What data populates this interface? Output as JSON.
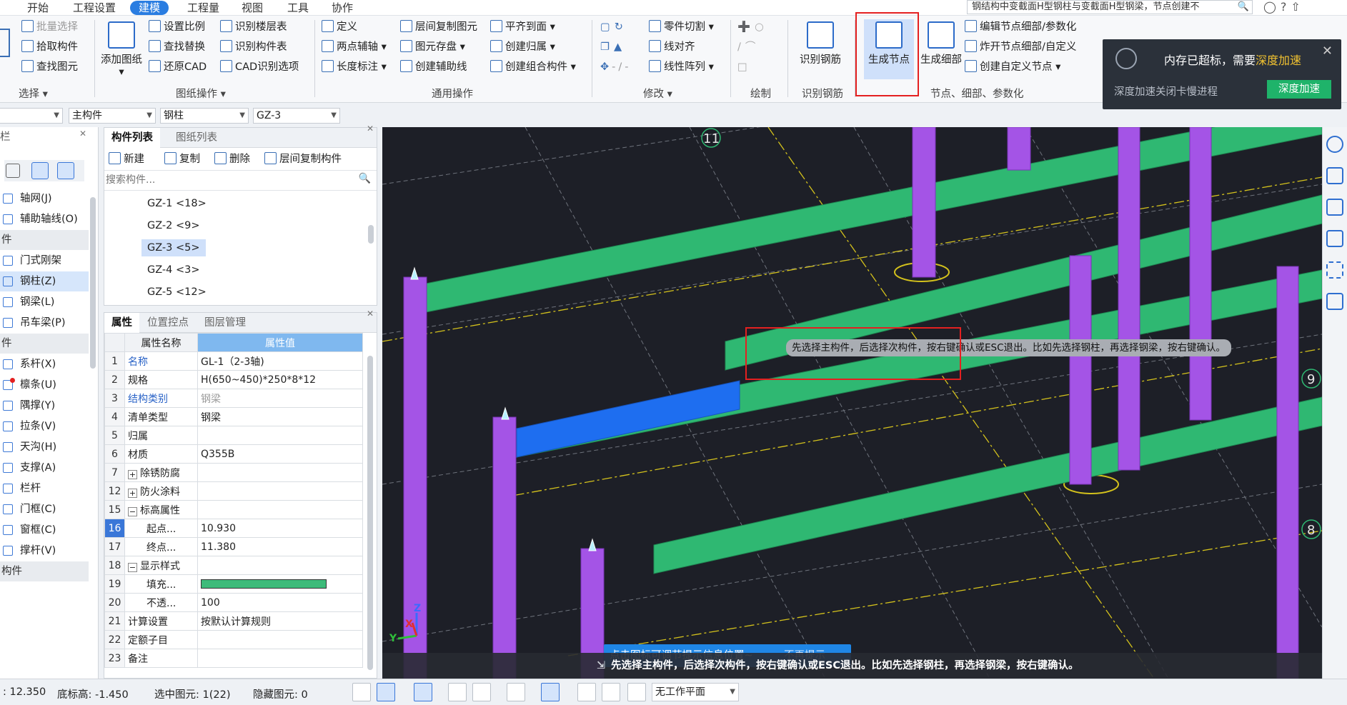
{
  "menu": {
    "items": [
      "开始",
      "工程设置",
      "建模",
      "工程量",
      "视图",
      "工具",
      "协作"
    ],
    "active_index": 2
  },
  "search": {
    "text": "钢结构中变截面H型钢柱与变截面H型钢梁，节点创建不"
  },
  "ribbon": {
    "select_group": {
      "rows": [
        "批量选择",
        "拾取构件",
        "查找图元"
      ],
      "label": "选择"
    },
    "drawing_ops": {
      "big": "添加图纸",
      "col1": [
        "设置比例",
        "查找替换",
        "还原CAD"
      ],
      "col2": [
        "识别楼层表",
        "识别构件表",
        "CAD识别选项"
      ],
      "label": "图纸操作"
    },
    "general_ops": {
      "col1": [
        "定义",
        "两点辅轴",
        "长度标注"
      ],
      "col2": [
        "层间复制图元",
        "图元存盘",
        "创建辅助线"
      ],
      "col3": [
        "平齐到面",
        "创建归属",
        "创建组合构件"
      ],
      "label": "通用操作"
    },
    "modify": {
      "col2": [
        "零件切割",
        "线对齐",
        "线性阵列"
      ],
      "label": "修改"
    },
    "draw": {
      "label": "绘制"
    },
    "identify": {
      "big": "识别钢筋",
      "label": "识别钢筋"
    },
    "node_group": {
      "big1": "生成节点",
      "big2": "生成细部",
      "col": [
        "编辑节点细部/参数化",
        "炸开节点细部/自定义",
        "创建自定义节点"
      ],
      "label": "节点、细部、参数化"
    }
  },
  "notification": {
    "title_prefix": "内存已超标，需要",
    "title_link": "深度加速",
    "subtitle": "深度加速关闭卡慢进程",
    "button": "深度加速"
  },
  "selectors": {
    "s1": "主构件",
    "s2": "钢柱",
    "s3": "GZ-3"
  },
  "left_sidebar": {
    "header": "栏",
    "items": [
      {
        "label": "轴网(J)"
      },
      {
        "label": "辅助轴线(O)"
      },
      {
        "label": "件",
        "section": true
      },
      {
        "label": "门式刚架"
      },
      {
        "label": "钢柱(Z)",
        "selected": true
      },
      {
        "label": "钢梁(L)"
      },
      {
        "label": "吊车梁(P)"
      },
      {
        "label": "件",
        "section": true
      },
      {
        "label": "系杆(X)"
      },
      {
        "label": "檩条(U)"
      },
      {
        "label": "隅撑(Y)"
      },
      {
        "label": "拉条(V)"
      },
      {
        "label": "天沟(H)"
      },
      {
        "label": "支撑(A)"
      },
      {
        "label": "栏杆"
      },
      {
        "label": "门框(C)"
      },
      {
        "label": "窗框(C)"
      },
      {
        "label": "撑杆(V)"
      },
      {
        "label": "构件",
        "section": true
      }
    ]
  },
  "component_panel": {
    "tabs": [
      "构件列表",
      "图纸列表"
    ],
    "toolbar": {
      "new": "新建",
      "copy": "复制",
      "delete": "删除",
      "floor_copy": "层间复制构件"
    },
    "search_placeholder": "搜索构件...",
    "items": [
      "GZ-1 <18>",
      "GZ-2 <9>",
      "GZ-3 <5>",
      "GZ-4 <3>",
      "GZ-5 <12>"
    ],
    "selected_index": 2
  },
  "property_panel": {
    "tabs": [
      "属性",
      "位置控点",
      "图层管理"
    ],
    "header": {
      "name": "属性名称",
      "value": "属性值"
    },
    "rows": [
      {
        "n": "1",
        "name": "名称",
        "value": "GL-1（2-3轴)",
        "link": true
      },
      {
        "n": "2",
        "name": "规格",
        "value": "H(650~450)*250*8*12"
      },
      {
        "n": "3",
        "name": "结构类别",
        "value": "钢梁",
        "link": true,
        "gray": true
      },
      {
        "n": "4",
        "name": "清单类型",
        "value": "钢梁"
      },
      {
        "n": "5",
        "name": "归属",
        "value": ""
      },
      {
        "n": "6",
        "name": "材质",
        "value": "Q355B"
      },
      {
        "n": "7",
        "name": "除锈防腐",
        "value": "",
        "expand": "+"
      },
      {
        "n": "12",
        "name": "防火涂料",
        "value": "",
        "expand": "+"
      },
      {
        "n": "15",
        "name": "标高属性",
        "value": "",
        "expand": "−"
      },
      {
        "n": "16",
        "name": "起点...",
        "value": "10.930",
        "indent": true,
        "numsel": true
      },
      {
        "n": "17",
        "name": "终点...",
        "value": "11.380",
        "indent": true
      },
      {
        "n": "18",
        "name": "显示样式",
        "value": "",
        "expand": "−"
      },
      {
        "n": "19",
        "name": "填充...",
        "value": "",
        "indent": true,
        "swatch": true
      },
      {
        "n": "20",
        "name": "不透...",
        "value": "100",
        "indent": true
      },
      {
        "n": "21",
        "name": "计算设置",
        "value": "按默认计算规则"
      },
      {
        "n": "22",
        "name": "定额子目",
        "value": ""
      },
      {
        "n": "23",
        "name": "备注",
        "value": ""
      }
    ]
  },
  "viewport": {
    "tooltip": "先选择主构件，后选择次构件，按右键确认或ESC退出。比如先选择钢柱，再选择钢梁，按右键确认。",
    "hint_text": "点击图标可调节提示信息位置~",
    "hint_dismiss": "不再提示",
    "bottom_hint": "先选择主构件，后选择次构件，按右键确认或ESC退出。比如先选择钢柱，再选择钢梁，按右键确认。",
    "grid_labels": [
      "11",
      "9",
      "8"
    ],
    "axis_labels": [
      "X",
      "Y",
      "Z"
    ],
    "colors": {
      "beam": "#2fb872",
      "column": "#a454e6",
      "selected_beam": "#1e6ef0",
      "background": "#1d1f27"
    }
  },
  "statusbar": {
    "elev": ": 12.350",
    "base": "底标高: -1.450",
    "selected": "选中图元: 1(22)",
    "hidden": "隐藏图元: 0",
    "workplane": "无工作平面"
  }
}
